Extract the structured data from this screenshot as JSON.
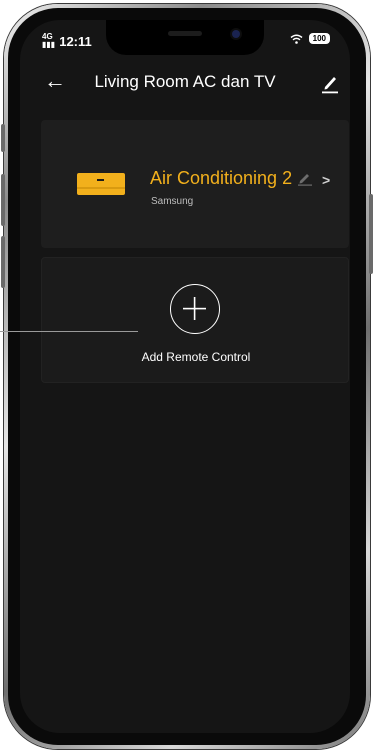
{
  "status_bar": {
    "network": "4G",
    "time": "12:11",
    "battery": "100"
  },
  "header": {
    "title": "Living Room AC dan TV"
  },
  "devices": [
    {
      "name": "Air Conditioning 2",
      "brand": "Samsung"
    }
  ],
  "add_remote": {
    "label": "Add Remote Control"
  },
  "colors": {
    "accent": "#f2b01c",
    "background": "#151515",
    "card": "#1e1e1e"
  }
}
